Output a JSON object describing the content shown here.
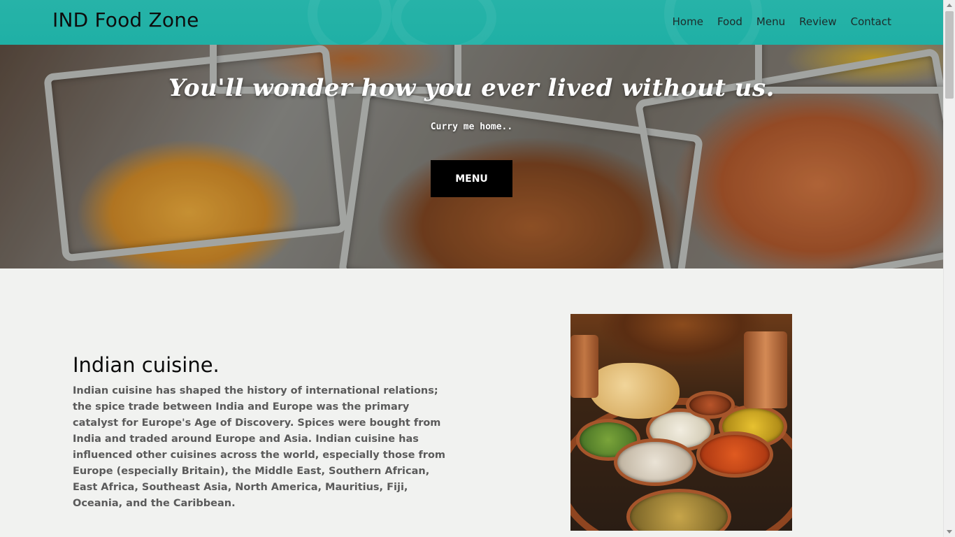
{
  "header": {
    "brand": "IND Food Zone",
    "nav": [
      "Home",
      "Food",
      "Menu",
      "Review",
      "Contact"
    ]
  },
  "hero": {
    "title": "You'll wonder how you ever lived without us.",
    "subtitle": "Curry me home..",
    "button_label": "MENU"
  },
  "about": {
    "heading": "Indian cuisine.",
    "body": "Indian cuisine has shaped the history of international relations; the spice trade between India and Europe was the primary catalyst for Europe's Age of Discovery. Spices were bought from India and traded around Europe and Asia. Indian cuisine has influenced other cuisines across the world, especially those from Europe (especially Britain), the Middle East, Southern African, East Africa, Southeast Asia, North America, Mauritius, Fiji, Oceania, and the Caribbean."
  },
  "colors": {
    "header_bg": "#1fb0a5",
    "page_bg": "#f1f2f0",
    "button_bg": "#000000",
    "body_text": "#5a5a5a"
  }
}
